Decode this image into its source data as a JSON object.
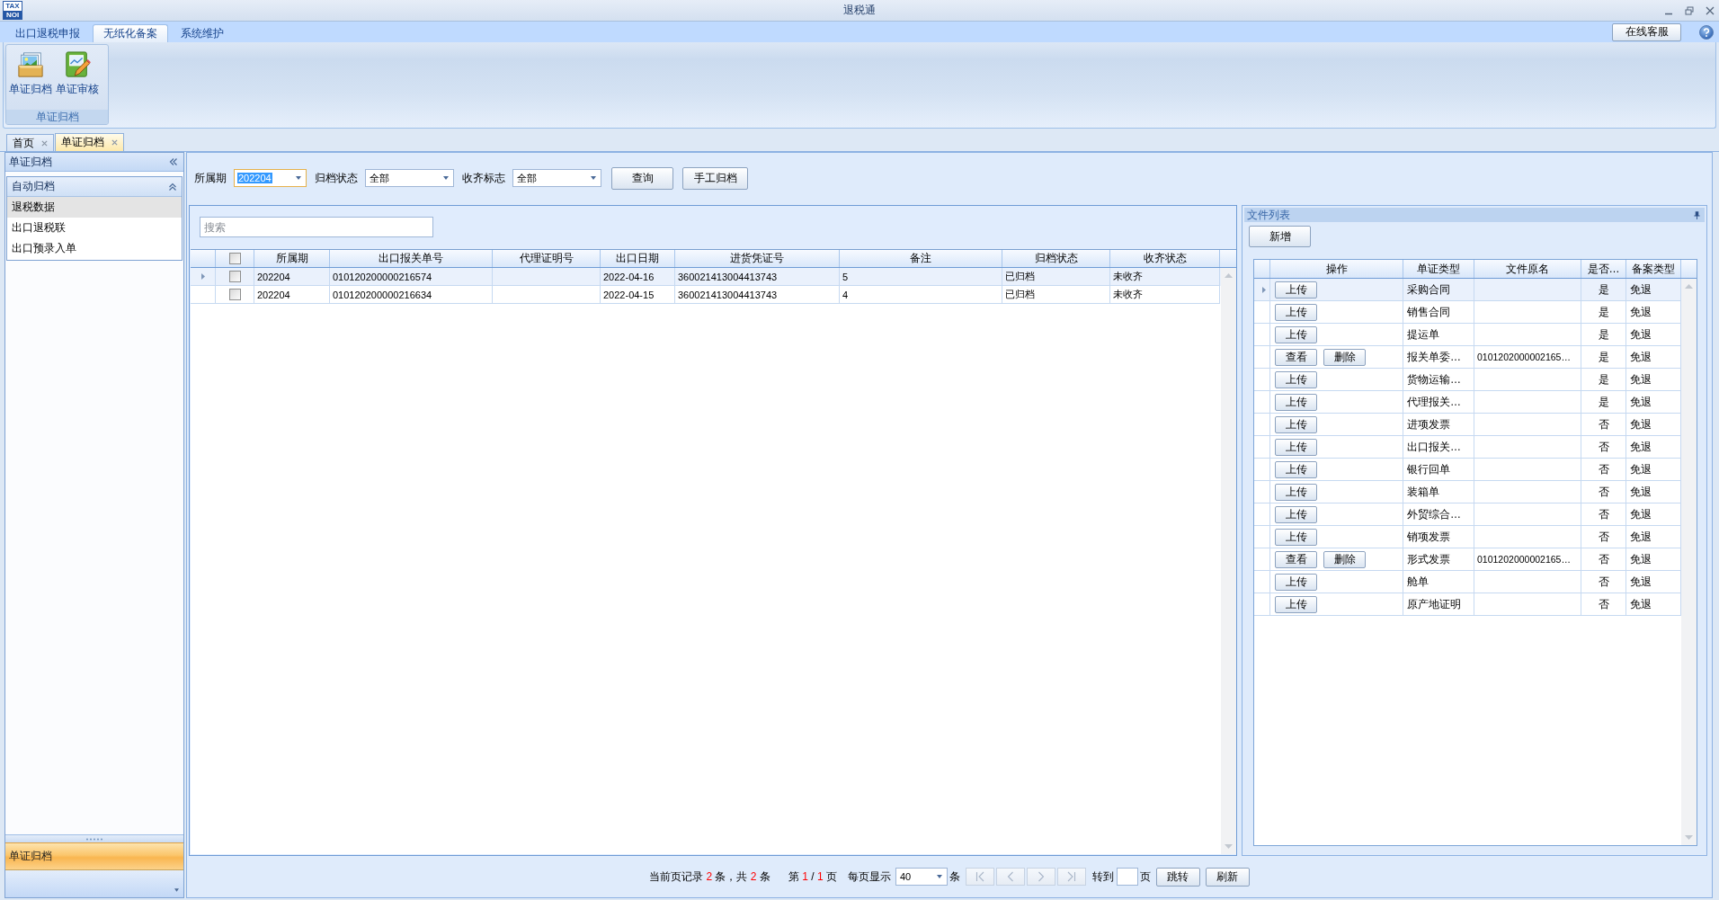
{
  "window": {
    "title": "退税通",
    "logo": [
      "TAX",
      "NOI"
    ]
  },
  "ribbon": {
    "tabs": [
      {
        "label": "出口退税申报",
        "selected": false
      },
      {
        "label": "无纸化备案",
        "selected": true
      },
      {
        "label": "系统维护",
        "selected": false
      }
    ],
    "service_button": "在线客服",
    "groups": [
      {
        "label": "单证归档",
        "buttons": [
          {
            "label": "单证归档",
            "kind": "archive"
          },
          {
            "label": "单证审核",
            "kind": "review"
          }
        ]
      }
    ]
  },
  "document_tabs": [
    {
      "label": "首页",
      "selected": false
    },
    {
      "label": "单证归档",
      "selected": true
    }
  ],
  "sidebar": {
    "title": "单证归档",
    "groups": [
      {
        "label": "自动归档",
        "expanded": true,
        "items": [
          {
            "label": "退税数据",
            "selected": true
          },
          {
            "label": "出口退税联",
            "selected": false
          },
          {
            "label": "出口预录入单",
            "selected": false
          }
        ]
      }
    ],
    "footer": {
      "label": "单证归档"
    }
  },
  "filters": {
    "fields": [
      {
        "label": "所属期",
        "value": "202204",
        "focused": true
      },
      {
        "label": "归档状态",
        "value": "全部",
        "focused": false
      },
      {
        "label": "收齐标志",
        "value": "全部",
        "focused": false
      }
    ],
    "buttons": [
      "查询",
      "手工归档"
    ]
  },
  "records_grid": {
    "search": {
      "placeholder": "搜索"
    },
    "select_all": {
      "checked": false
    },
    "columns": [
      "所属期",
      "出口报关单号",
      "代理证明号",
      "出口日期",
      "进货凭证号",
      "备注",
      "归档状态",
      "收齐状态"
    ],
    "rows": [
      {
        "selected": true,
        "checked": false,
        "period": "202204",
        "declaration_no": "010120200000216574",
        "export_date": "2022-04-16",
        "voucher_no": "360021413004413743",
        "remark": "5",
        "archive_status": "已归档",
        "collect_status": "未收齐"
      },
      {
        "selected": false,
        "checked": false,
        "period": "202204",
        "declaration_no": "010120200000216634",
        "export_date": "2022-04-15",
        "voucher_no": "360021413004413743",
        "remark": "4",
        "archive_status": "已归档",
        "collect_status": "未收齐"
      }
    ]
  },
  "file_list": {
    "title": "文件列表",
    "add_button": "新增",
    "columns": [
      "操作",
      "单证类型",
      "文件原名",
      "是否…",
      "备案类型"
    ],
    "rows": [
      {
        "selected": true,
        "actions": [
          "上传"
        ],
        "doc_type": "采购合同",
        "required": "是",
        "filing_type": "免退"
      },
      {
        "selected": false,
        "actions": [
          "上传"
        ],
        "doc_type": "销售合同",
        "required": "是",
        "filing_type": "免退"
      },
      {
        "selected": false,
        "actions": [
          "上传"
        ],
        "doc_type": "提运单",
        "required": "是",
        "filing_type": "免退"
      },
      {
        "selected": false,
        "actions": [
          "查看",
          "删除"
        ],
        "doc_type": "报关单委…",
        "file_name": "0101202000002165…",
        "required": "是",
        "filing_type": "免退"
      },
      {
        "selected": false,
        "actions": [
          "上传"
        ],
        "doc_type": "货物运输…",
        "required": "是",
        "filing_type": "免退"
      },
      {
        "selected": false,
        "actions": [
          "上传"
        ],
        "doc_type": "代理报关…",
        "required": "是",
        "filing_type": "免退"
      },
      {
        "selected": false,
        "actions": [
          "上传"
        ],
        "doc_type": "进项发票",
        "required": "否",
        "filing_type": "免退"
      },
      {
        "selected": false,
        "actions": [
          "上传"
        ],
        "doc_type": "出口报关…",
        "required": "否",
        "filing_type": "免退"
      },
      {
        "selected": false,
        "actions": [
          "上传"
        ],
        "doc_type": "银行回单",
        "required": "否",
        "filing_type": "免退"
      },
      {
        "selected": false,
        "actions": [
          "上传"
        ],
        "doc_type": "装箱单",
        "required": "否",
        "filing_type": "免退"
      },
      {
        "selected": false,
        "actions": [
          "上传"
        ],
        "doc_type": "外贸综合…",
        "required": "否",
        "filing_type": "免退"
      },
      {
        "selected": false,
        "actions": [
          "上传"
        ],
        "doc_type": "销项发票",
        "required": "否",
        "filing_type": "免退"
      },
      {
        "selected": false,
        "actions": [
          "查看",
          "删除"
        ],
        "doc_type": "形式发票",
        "file_name": "0101202000002165…",
        "required": "否",
        "filing_type": "免退"
      },
      {
        "selected": false,
        "actions": [
          "上传"
        ],
        "doc_type": "舱单",
        "required": "否",
        "filing_type": "免退"
      },
      {
        "selected": false,
        "actions": [
          "上传"
        ],
        "doc_type": "原产地证明",
        "required": "否",
        "filing_type": "免退"
      }
    ]
  },
  "pagination": {
    "record_summary": [
      {
        "kind": "label",
        "text": "当前页记录"
      },
      {
        "kind": "count",
        "text": "2"
      },
      {
        "kind": "label",
        "text": "条，共"
      },
      {
        "kind": "count",
        "text": "2"
      },
      {
        "kind": "label",
        "text": "条"
      }
    ],
    "page_info": [
      {
        "kind": "label",
        "text": "第"
      },
      {
        "kind": "count",
        "text": "1"
      },
      {
        "kind": "label",
        "text": "/"
      },
      {
        "kind": "count",
        "text": "1"
      },
      {
        "kind": "label",
        "text": "页"
      }
    ],
    "page_size_label": "每页显示",
    "page_size": "40",
    "page_size_unit": "条",
    "nav_buttons": [
      {
        "kind": "first",
        "disabled": true
      },
      {
        "kind": "prev",
        "disabled": true
      },
      {
        "kind": "next",
        "disabled": true
      },
      {
        "kind": "last",
        "disabled": true
      }
    ],
    "goto_label": "转到",
    "goto_unit": "页",
    "goto_button": "跳转",
    "refresh_button": "刷新"
  }
}
